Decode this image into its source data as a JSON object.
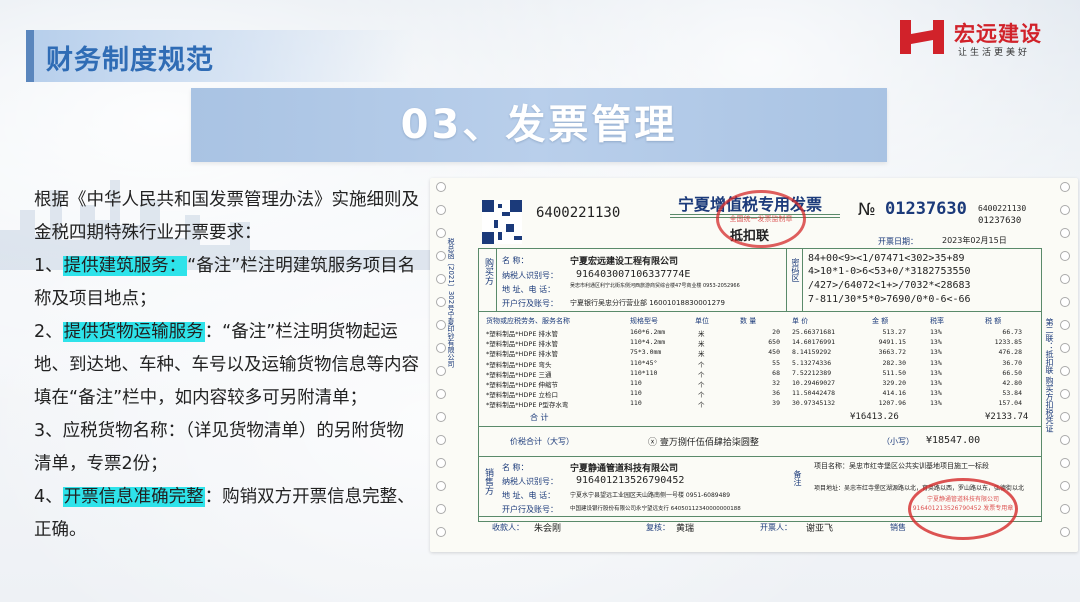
{
  "header": {
    "page_title": "财务制度规范",
    "logo_name": "宏远建设",
    "logo_slogan": "让生活更美好"
  },
  "section": {
    "title": "03、发票管理"
  },
  "body": {
    "intro": "根据《中华人民共和国发票管理办法》实施细则及金税四期特殊行业开票要求：",
    "item1_prefix": "1、",
    "item1_highlight": "提供建筑服务：",
    "item1_text": "“备注”栏注明建筑服务项目名称及项目地点；",
    "item2_prefix": "2、",
    "item2_highlight": "提供货物运输服务",
    "item2_text": "：“备注”栏注明货物起运地、到达地、车种、车号以及运输货物信息等内容填在“备注”栏中，如内容较多可另附清单；",
    "item3_text": "3、应税货物名称：（详见货物清单）的另附货物清单，专票2份；",
    "item4_prefix": "4、",
    "item4_highlight": "开票信息准确完整",
    "item4_text": "：购销双方开票信息完整、正确。"
  },
  "invoice": {
    "code": "6400221130",
    "title": "宁夏增值税专用发票",
    "copy": "抵扣联",
    "no_label": "№",
    "number": "01237630",
    "code_right": "6400221130",
    "number_right": "01237630",
    "date_label": "开票日期：",
    "date": "2023年02月15日",
    "buyer_label": "购买方",
    "buyer_name_label": "名    称：",
    "buyer_name": "宁夏宏远建设工程有限公司",
    "buyer_tax_label": "纳税人识别号：",
    "buyer_tax": "916403007106337774E",
    "buyer_addr_label": "地 址、电 话：",
    "buyer_addr": "吴忠市利通区利宁北街东侧河西旅游商贸综合楼47号商业楼 0953-2052966",
    "buyer_bank_label": "开户行及账号：",
    "buyer_bank": "宁夏银行吴忠分行营业部 16001018830001279",
    "cipher_label": "密码区",
    "cipher": [
      "84+00<9><1/07471<302>35+89",
      "4>10*1-0>6<53+0/*3182753550",
      "/427>/64072<1+>/7032*<28683",
      "7-811/30*5*0>7690/0*0-6<-66"
    ],
    "cols": [
      "货物或应税劳务、服务名称",
      "规格型号",
      "单位",
      "数 量",
      "单 价",
      "金 额",
      "税率",
      "税 额"
    ],
    "rows": [
      [
        "*塑料制品*HDPE 排水管",
        "160*6.2mm",
        "米",
        "20",
        "25.66371681",
        "513.27",
        "13%",
        "66.73"
      ],
      [
        "*塑料制品*HDPE 排水管",
        "110*4.2mm",
        "米",
        "650",
        "14.60176991",
        "9491.15",
        "13%",
        "1233.85"
      ],
      [
        "*塑料制品*HDPE 排水管",
        "75*3.0mm",
        "米",
        "450",
        "8.14159292",
        "3663.72",
        "13%",
        "476.28"
      ],
      [
        "*塑料制品*HDPE 弯头",
        "110*45°",
        "个",
        "55",
        "5.13274336",
        "282.30",
        "13%",
        "36.70"
      ],
      [
        "*塑料制品*HDPE 三通",
        "110*110",
        "个",
        "68",
        "7.52212389",
        "511.50",
        "13%",
        "66.50"
      ],
      [
        "*塑料制品*HDPE 伸缩节",
        "110",
        "个",
        "32",
        "10.29469027",
        "329.20",
        "13%",
        "42.80"
      ],
      [
        "*塑料制品*HDPE 立检口",
        "110",
        "个",
        "36",
        "11.50442478",
        "414.16",
        "13%",
        "53.84"
      ],
      [
        "*塑料制品*HDPE P型存水弯",
        "110",
        "个",
        "39",
        "30.97345132",
        "1207.96",
        "13%",
        "157.04"
      ]
    ],
    "total_label": "合 计",
    "total_amount": "¥16413.26",
    "total_tax": "¥2133.74",
    "grand_label": "价税合计（大写）",
    "grand_words": "ⓧ 壹万捌仟伍佰肆拾柒圆整",
    "grand_small_label": "（小写）",
    "grand_small": "¥18547.00",
    "seller_label": "销售方",
    "seller_name": "宁夏静通管道科技有限公司",
    "seller_tax": "916401213526790452",
    "seller_addr": "宁夏水宁县望远工业园区天山路南侧一号楼 0951-6089489",
    "seller_bank": "中国建设银行股份有限公司永宁望远支行 64050112340000000188",
    "remark_label": "备注",
    "remark": "项目名称：吴忠市红寺堡区公共实训基地项目施工一标段",
    "remark2": "项目地址：吴忠市红寺堡区湖源路以北，育英路以西，罗山路以东，弘德街以北",
    "payee_label": "收款人：",
    "payee": "朱会刚",
    "checker_label": "复核：",
    "checker": "黄瑞",
    "drawer_label": "开票人：",
    "drawer": "谢亚飞",
    "seller_sign_label": "销售",
    "side_note": "税总函〔2021〕302号宁夏印钞有限公司",
    "side_right": "第二联：抵扣联 购买方扣税凭证",
    "stamp1_text": "全国统一发票监制章",
    "stamp2_text": "宁夏静通管道科技有限公司 916401213526790452 发票专用章"
  }
}
